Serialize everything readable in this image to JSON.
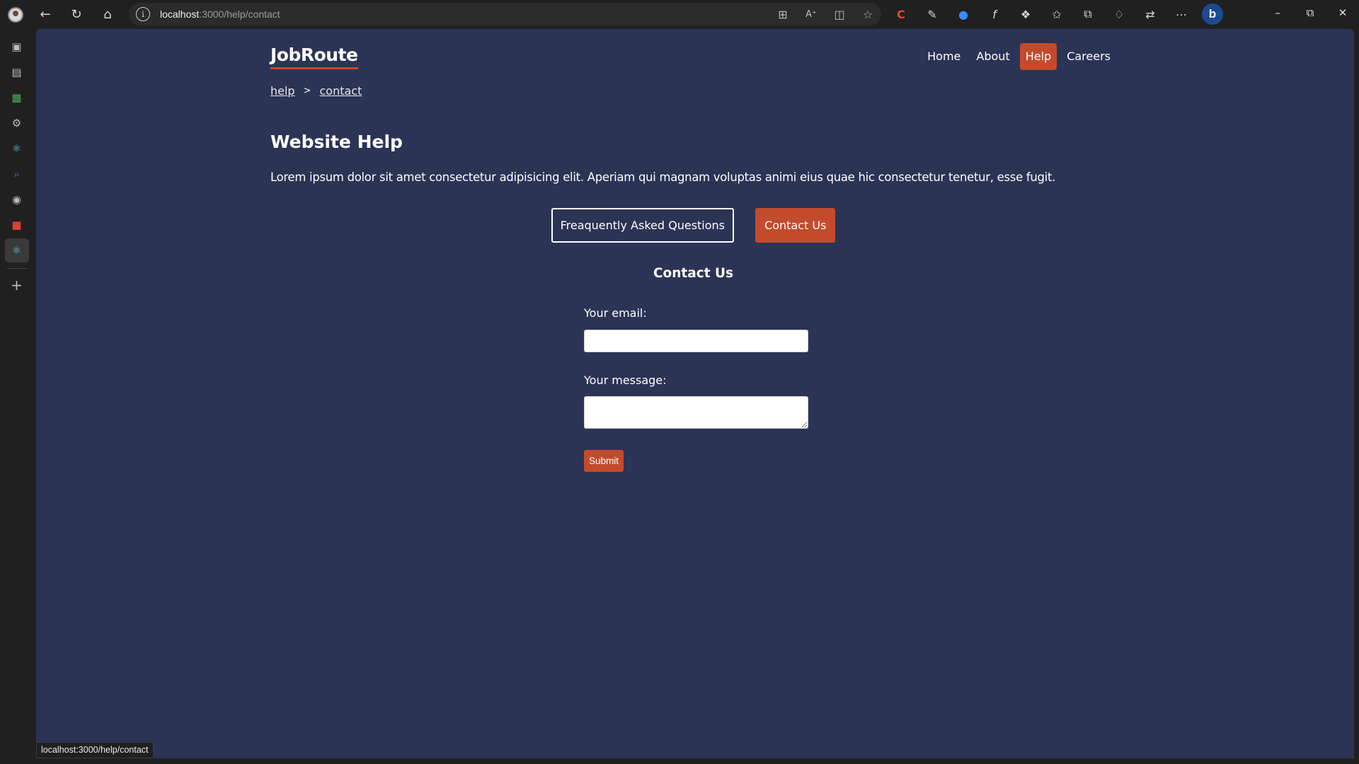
{
  "browser": {
    "url_host": "localhost",
    "url_rest": ":3000/help/contact",
    "status_url": "localhost:3000/help/contact"
  },
  "site": {
    "logo": "JobRoute",
    "nav": [
      {
        "label": "Home",
        "active": false
      },
      {
        "label": "About",
        "active": false
      },
      {
        "label": "Help",
        "active": true
      },
      {
        "label": "Careers",
        "active": false
      }
    ],
    "breadcrumb": {
      "items": [
        "help",
        "contact"
      ],
      "separator": ">"
    }
  },
  "help": {
    "title": "Website Help",
    "body": "Lorem ipsum dolor sit amet consectetur adipisicing elit. Aperiam qui magnam voluptas animi eius quae hic consectetur tenetur, esse fugit.",
    "faq_button": "Freaquently Asked Questions",
    "contact_button": "Contact Us"
  },
  "contact": {
    "title": "Contact Us",
    "email_label": "Your email:",
    "email_value": "",
    "message_label": "Your message:",
    "message_value": "",
    "submit_label": "Submit"
  },
  "colors": {
    "page_bg": "#2b3455",
    "accent": "#c44a2c",
    "chrome_bg": "#202020"
  }
}
